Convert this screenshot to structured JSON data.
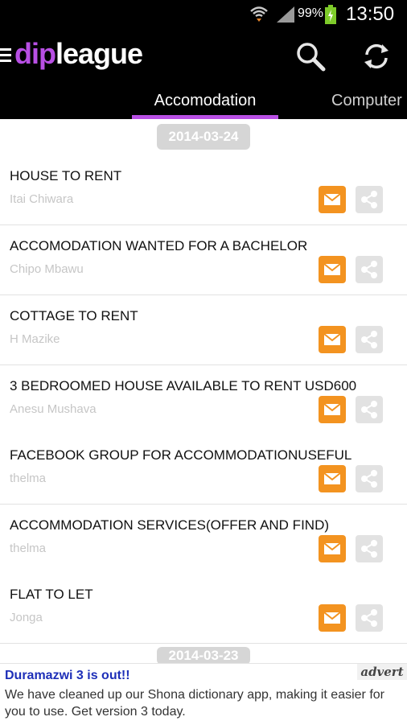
{
  "status_bar": {
    "battery": "99%",
    "time": "13:50"
  },
  "app": {
    "logo_part1": "dip",
    "logo_part2": "league"
  },
  "tabs": [
    {
      "label": "Accomodation",
      "active": true
    },
    {
      "label": "Computer"
    }
  ],
  "date_headers": [
    "2014-03-24",
    "2014-03-23"
  ],
  "listings": [
    {
      "title": "HOUSE TO RENT",
      "author": "Itai Chiwara"
    },
    {
      "title": "ACCOMODATION  WANTED FOR A BACHELOR",
      "author": "Chipo Mbawu"
    },
    {
      "title": "COTTAGE TO RENT",
      "author": "H Mazike"
    },
    {
      "title": "3 BEDROOMED HOUSE AVAILABLE TO RENT  USD600",
      "author": "Anesu Mushava"
    },
    {
      "title": "FACEBOOK GROUP FOR ACCOMMODATIONUSEFUL",
      "author": "thelma"
    },
    {
      "title": "ACCOMMODATION SERVICES(OFFER AND FIND)",
      "author": "thelma"
    },
    {
      "title": "FLAT TO LET",
      "author": "Jonga"
    }
  ],
  "ad": {
    "title": "Duramazwi 3 is out!!",
    "label": "advert",
    "body": "We have cleaned up our Shona dictionary app, making it easier for you to use. Get version 3 today."
  },
  "colors": {
    "accent": "#b84fe4",
    "mail": "#f39320",
    "share": "#e2e2e2",
    "ad_title": "#1e2fb8"
  },
  "icons": [
    "menu-icon",
    "search-icon",
    "refresh-icon",
    "mail-icon",
    "share-icon",
    "wifi-icon",
    "signal-icon",
    "battery-icon"
  ]
}
